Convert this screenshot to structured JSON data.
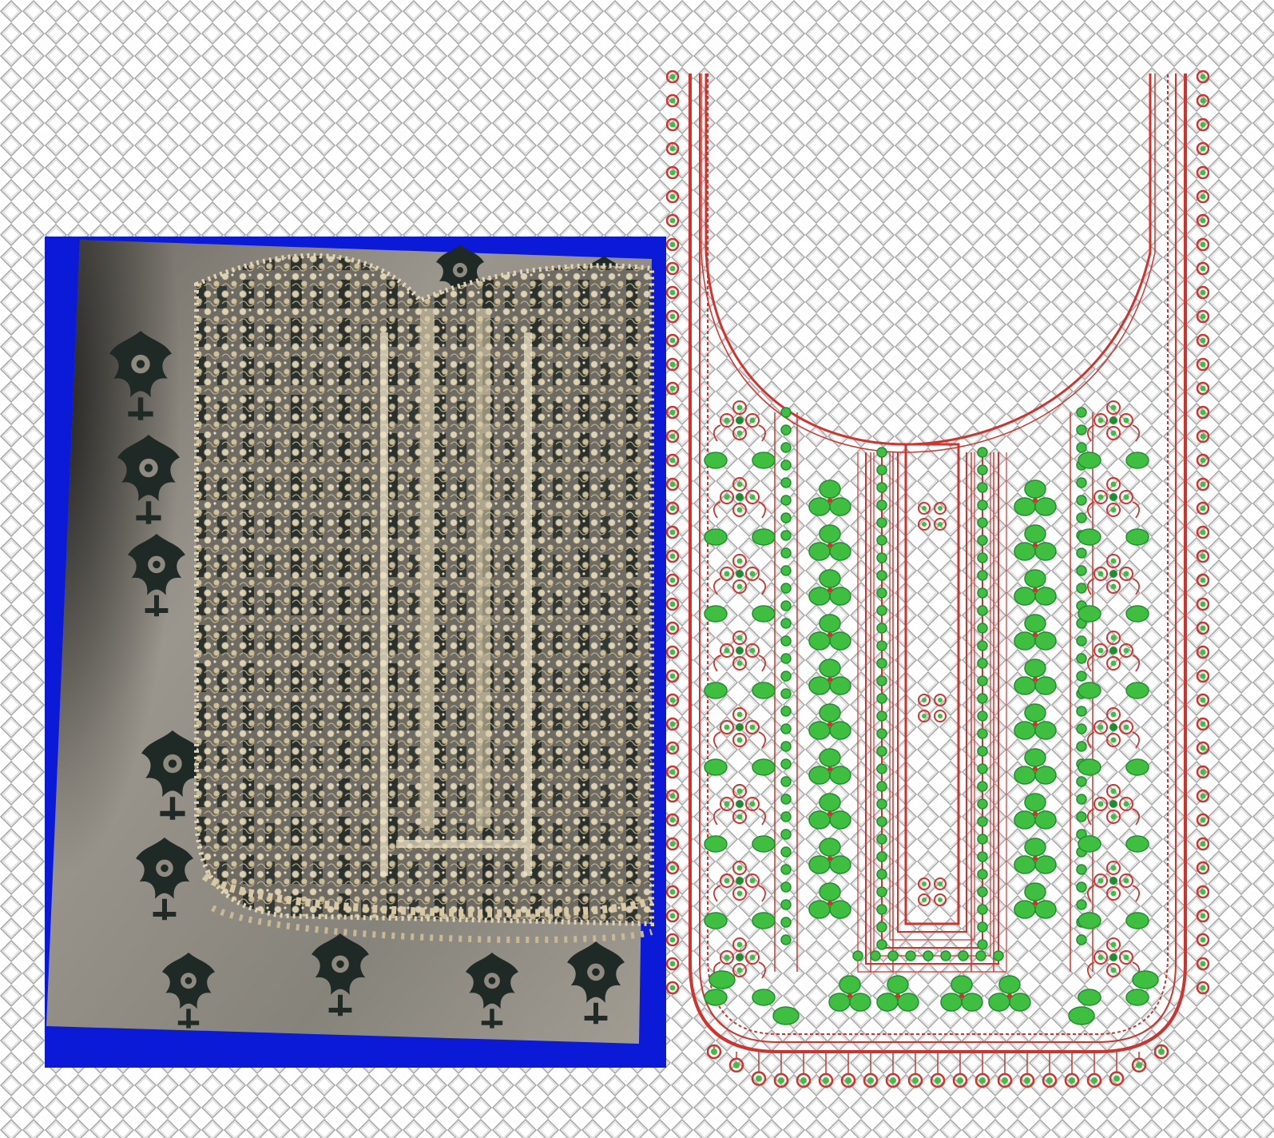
{
  "scene": {
    "caption": "",
    "colors": {
      "mesh_line": "#9a9a9a",
      "mesh_bg": "#ffffff",
      "photo_border": "#0a1ad6",
      "fabric_base": "#8f8a82",
      "fabric_dark": "#2c2f2c",
      "motif_dark": "#1f2a26",
      "gold": "#d8c7a0",
      "gold_dark": "#8a7a58",
      "thread_red": "#d3322c",
      "thread_green": "#3fbf3f",
      "thread_green_dark": "#1e8f2e"
    },
    "panels": [
      {
        "name": "fabric-photo",
        "icon": "embroidered-fabric-photo"
      },
      {
        "name": "embroidery-design",
        "icon": "neckline-embroidery-pattern"
      }
    ]
  }
}
